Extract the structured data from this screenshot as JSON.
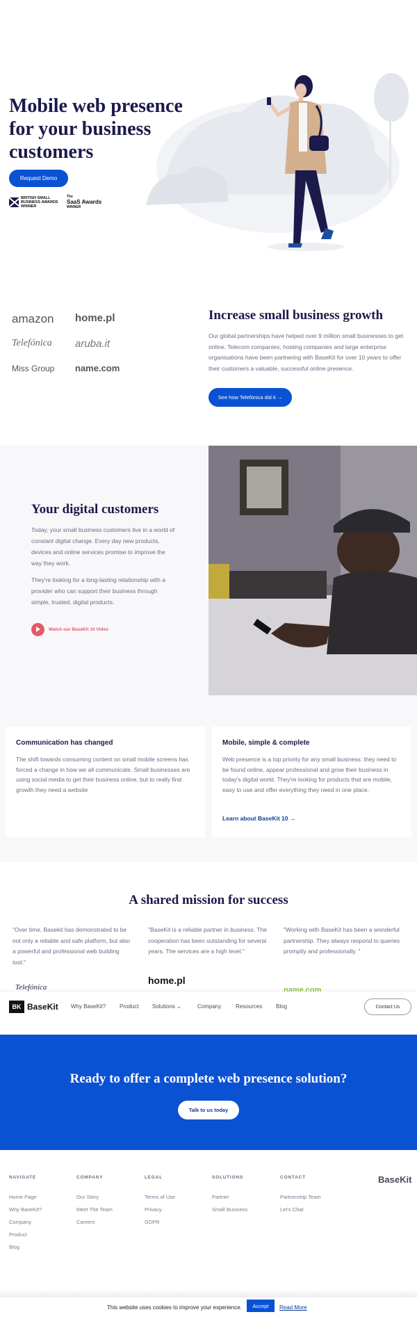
{
  "hero": {
    "title": "Mobile web presence for your business customers",
    "cta_label": "Request Demo",
    "award1": "BRITISH SMALL BUSINESS AWARDS WINNER",
    "award2_top": "The",
    "award2_main": "SaaS Awards",
    "award2_sub": "WINNER"
  },
  "partners": {
    "logos": [
      "amazon",
      "home.pl",
      "Telefónica",
      "aruba.it",
      "Miss Group",
      "name.com"
    ],
    "title": "Increase small business growth",
    "text": "Our global partnerships have helped over 9 million small businesses to get online. Telecom companies, hosting companies and large enterprise organisations have been partnering with BaseKit for over 10 years to offer their customers a valuable, successful online presence.",
    "cta_label": "See how Telefónica did it →"
  },
  "digital": {
    "title": "Your digital customers",
    "para1": "Today, your small business customers live in a world of constant digital change. Every day new products, devices and online services promise to improve the way they work.",
    "para2": "They're looking for a long-lasting relationship with a provider who can support their business through simple, trusted, digital products.",
    "video_label": "Watch our BaseKit 10 Video"
  },
  "cards": [
    {
      "title": "Communication has changed",
      "text": "The shift towards consuming content on small mobile screens has forced a change in how we all communicate. Small businesses are using social media to get their business online, but to really find growth they need a website"
    },
    {
      "title": "Mobile, simple & complete",
      "text": "Web presence is a top priority for any small business: they need to be found online, appear professional and grow their business in today's digital world. They're looking for products that are mobile, easy to use and offer everything they need in one place.",
      "link": "Learn about BaseKit 10 →"
    }
  ],
  "mission": {
    "title": "A shared mission for success",
    "quotes": [
      {
        "text": "\"Over time, Basekit has demonstrated to be not only a reliable and safe platform, but also a powerful and professional web building tool.\"",
        "logo": "Telefónica"
      },
      {
        "text": "\"BaseKit is a reliable partner in business. The cooperation has been outstanding for several years. The services are a high level.\"",
        "logo": "home.pl"
      },
      {
        "text": "\"Working with BaseKit has been a wonderful partnership. They always respond to queries promptly and professionally. \"",
        "logo": "name.com"
      }
    ]
  },
  "nav": {
    "logo_mark": "BK",
    "logo_name": "BaseKit",
    "items": [
      "Why BaseKit?",
      "Product",
      "Solutions ⌄",
      "Company",
      "Resources",
      "Blog"
    ],
    "contact_label": "Contact Us"
  },
  "banner": {
    "title": "Ready to offer a complete web presence solution?",
    "cta_label": "Talk to us today"
  },
  "footer": {
    "columns": [
      {
        "heading": "NAVIGATE",
        "links": [
          "Home Page",
          "Why BaseKit?",
          "Company",
          "Product",
          "Blog"
        ]
      },
      {
        "heading": "COMPANY",
        "links": [
          "Our Story",
          "Meet The Team",
          "Careers"
        ]
      },
      {
        "heading": "LEGAL",
        "links": [
          "Terms of Use",
          "Privacy",
          "GDPR"
        ]
      },
      {
        "heading": "SOLUTIONS",
        "links": [
          "Partner",
          "Small Business"
        ]
      },
      {
        "heading": "CONTACT",
        "links": [
          "Partnership Team",
          "Let's Chat"
        ]
      }
    ],
    "logo": "BaseKit"
  },
  "cookie": {
    "text": "This website uses cookies to improve your experience.",
    "accept_label": "Accept",
    "more_label": "Read More"
  },
  "colors": {
    "brand_blue": "#0a52d3",
    "navy": "#1b1a4b",
    "video_red": "#e35a66"
  }
}
